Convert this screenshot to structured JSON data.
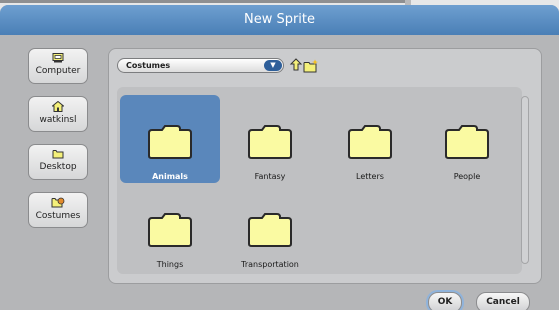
{
  "dialog": {
    "title": "New Sprite"
  },
  "places": [
    {
      "label": "Computer",
      "icon": "computer-icon"
    },
    {
      "label": "watkinsl",
      "icon": "home-icon"
    },
    {
      "label": "Desktop",
      "icon": "folder-icon"
    },
    {
      "label": "Costumes",
      "icon": "costumes-icon"
    }
  ],
  "path": {
    "current": "Costumes"
  },
  "folders": [
    {
      "label": "Animals",
      "selected": true
    },
    {
      "label": "Fantasy"
    },
    {
      "label": "Letters"
    },
    {
      "label": "People"
    },
    {
      "label": "Things"
    },
    {
      "label": "Transportation"
    }
  ],
  "buttons": {
    "ok": "OK",
    "cancel": "Cancel"
  },
  "colors": {
    "title_bar": "#5a8ec4",
    "selected": "#5a87bb",
    "folder_fill": "#fafaa2"
  }
}
